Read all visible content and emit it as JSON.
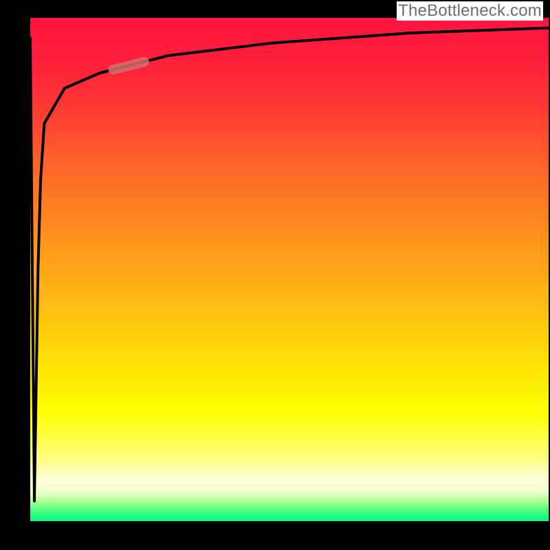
{
  "watermark": "TheBottleneck.com",
  "chart_data": {
    "type": "line",
    "title": "",
    "xlabel": "",
    "ylabel": "",
    "xlim": [
      0,
      100
    ],
    "ylim": [
      0,
      100
    ],
    "series": [
      {
        "name": "curve",
        "x": [
          0.0,
          0.8,
          1.5,
          2.0,
          2.7,
          6.6,
          13.3,
          26.6,
          46.6,
          73.3,
          100.0
        ],
        "values": [
          96.0,
          4.0,
          50.0,
          68.0,
          79.0,
          86.0,
          89.0,
          92.5,
          95.0,
          97.0,
          98.0
        ]
      }
    ],
    "marker": {
      "note": "short salmon dash on curve",
      "x_range": [
        16.0,
        22.0
      ],
      "y_approx": 89.5
    },
    "background_gradient": {
      "top": "#ff153f",
      "mid": "#ffff00",
      "bottom": "#00ff88"
    }
  }
}
